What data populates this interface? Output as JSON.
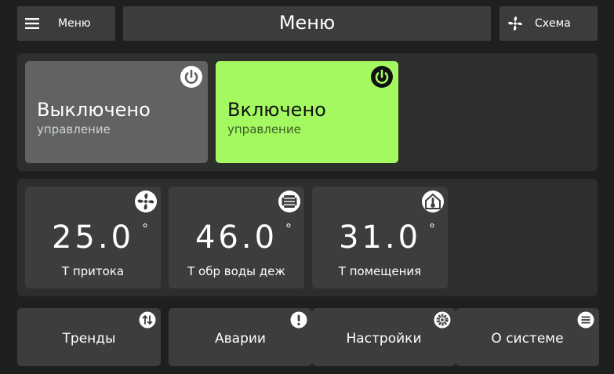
{
  "header": {
    "menu_label": "Меню",
    "title": "Меню",
    "scheme_label": "Схема"
  },
  "modes": [
    {
      "title": "Выключено",
      "subtitle": "управление",
      "state": "off",
      "color": "#606360",
      "icon": "power-icon"
    },
    {
      "title": "Включено",
      "subtitle": "управление",
      "state": "on",
      "color": "#a3f95f",
      "icon": "power-icon"
    }
  ],
  "sensors": [
    {
      "value": "25.0",
      "unit": "°",
      "caption": "Т притока",
      "icon": "fan-icon"
    },
    {
      "value": "46.0",
      "unit": "°",
      "caption": "Т обр воды деж",
      "icon": "radiator-icon"
    },
    {
      "value": "31.0",
      "unit": "°",
      "caption": "Т помещения",
      "icon": "house-thermometer-icon"
    }
  ],
  "nav": [
    {
      "label": "Тренды",
      "icon": "trends-icon"
    },
    {
      "label": "Аварии",
      "icon": "alert-icon"
    },
    {
      "label": "Настройки",
      "icon": "gear-icon"
    },
    {
      "label": "О системе",
      "icon": "list-icon"
    }
  ],
  "colors": {
    "background": "#1d201d",
    "panel": "#2c2f2c",
    "tile": "#3b3e3b",
    "accent_on": "#a3f95f"
  }
}
